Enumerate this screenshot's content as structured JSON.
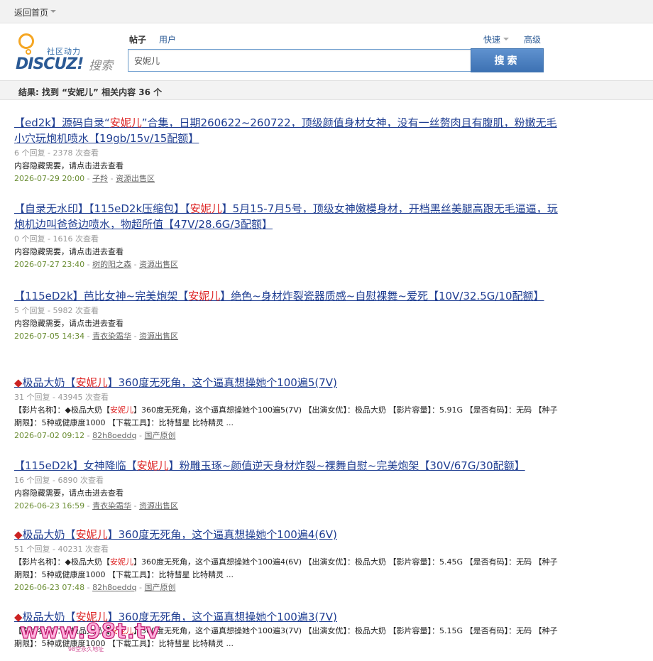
{
  "topbar": {
    "home_label": "返回首页"
  },
  "logo": {
    "tagline": "社区动力",
    "wordmark": "DISCUZ!",
    "search_word": "搜索"
  },
  "search": {
    "tabs": [
      {
        "label": "帖子"
      },
      {
        "label": "用户"
      }
    ],
    "quick_label": "快速",
    "advanced_label": "高级",
    "query": "安妮儿",
    "button_label": "搜索"
  },
  "result_summary": "结果: 找到 “安妮儿” 相关内容 36 个",
  "results": [
    {
      "title_pre": "【ed2k】源码自录“",
      "title_hl": "安妮儿",
      "title_post": "”合集，日期260622~260722，顶级颜值身材女神，没有一丝赘肉且有腹肌，粉嫩无毛小穴玩炮机喷水【19gb/15v/15配额】",
      "meta": "6 个回复 - 2378 次查看",
      "snippet_pre": "内容隐藏需要，请点击进去查看",
      "snippet_hl": "",
      "snippet_post": "",
      "date": "2026-07-29 20:00",
      "author": "子羚",
      "forum": "资源出售区"
    },
    {
      "title_pre": "【自录无水印】【115eD2k压缩包】【",
      "title_hl": "安妮儿",
      "title_post": "】5月15-7月5号，顶级女神嫩模身材，开档黑丝美腿高跟无毛逼逼，玩炮机边叫爸爸边喷水，物超所值【47V/28.6G/3配额】",
      "meta": "0 个回复 - 1616 次查看",
      "snippet_pre": "内容隐藏需要，请点击进去查看",
      "snippet_hl": "",
      "snippet_post": "",
      "date": "2026-07-27 23:40",
      "author": "树的阳之森",
      "forum": "资源出售区"
    },
    {
      "title_pre": "【115eD2k】芭比女神~完美炮架【",
      "title_hl": "安妮儿",
      "title_post": "】绝色~身材炸裂瓷器质感~自慰裸舞~爱死【10V/32.5G/10配额】",
      "meta": "5 个回复 - 5982 次查看",
      "snippet_pre": "内容隐藏需要，请点击进去查看",
      "snippet_hl": "",
      "snippet_post": "",
      "date": "2026-07-05 14:34",
      "author": "青衣染霜华",
      "forum": "资源出售区"
    },
    {
      "title_pre": "极品大奶【",
      "title_hl": "安妮儿",
      "title_post": "】360度无死角，这个逼真想操她个100遍5(7V)",
      "meta": "31 个回复 - 43945 次查看",
      "snippet_pre": "【影片名称】：◆极品大奶【",
      "snippet_hl": "安妮儿",
      "snippet_post": "】360度无死角，这个逼真想操她个100遍5(7V) 【出演女优】：极品大奶 【影片容量】：5.91G 【是否有码】：无码 【种子期限】：5种或健康度1000 【下载工具】：比特彗星 比特精灵 ...",
      "date": "2026-07-02 09:12",
      "author": "82h8oeddq",
      "forum": "国产原创"
    },
    {
      "title_pre": "【115eD2k】女神降临【",
      "title_hl": "安妮儿",
      "title_post": "】粉雕玉琢~颜值逆天身材炸裂~裸舞自慰~完美炮架【30V/67G/30配额】",
      "meta": "16 个回复 - 6890 次查看",
      "snippet_pre": "内容隐藏需要，请点击进去查看",
      "snippet_hl": "",
      "snippet_post": "",
      "date": "2026-06-23 16:59",
      "author": "青衣染霜华",
      "forum": "资源出售区"
    },
    {
      "title_pre": "极品大奶【",
      "title_hl": "安妮儿",
      "title_post": "】360度无死角，这个逼真想操她个100遍4(6V)",
      "meta": "51 个回复 - 40231 次查看",
      "snippet_pre": "【影片名称】：◆极品大奶【",
      "snippet_hl": "安妮儿",
      "snippet_post": "】360度无死角，这个逼真想操她个100遍4(6V) 【出演女优】：极品大奶 【影片容量】：5.45G 【是否有码】：无码 【种子期限】：5种或健康度1000 【下载工具】：比特彗星 比特精灵 ...",
      "date": "2026-06-23 07:48",
      "author": "82h8oeddq",
      "forum": "国产原创"
    },
    {
      "title_pre": "极品大奶【",
      "title_hl": "安妮儿",
      "title_post": "】360度无死角，这个逼真想操她个100遍3(7V)",
      "meta": "",
      "snippet_pre": "【影片名称】：◆极品大奶【",
      "snippet_hl": "安妮儿",
      "snippet_post": "】360度无死角，这个逼真想操她个100遍3(7V) 【出演女优】：极品大奶 【影片容量】：5.15G 【是否有码】：无码 【种子期限】：5种或健康度1000 【下载工具】：比特彗星 比特精灵 ...",
      "date": "",
      "author": "",
      "forum": ""
    }
  ],
  "watermark": {
    "text": "www.98t.tv",
    "subtext": "98堂永久地址"
  }
}
